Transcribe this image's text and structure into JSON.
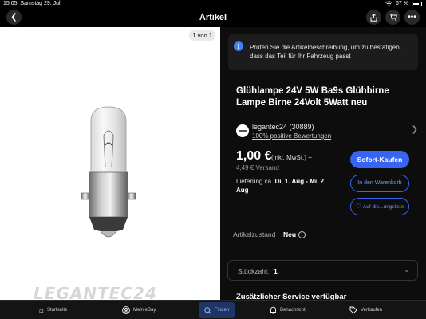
{
  "status_bar": {
    "time": "15:05",
    "date": "Samstag 29. Juli",
    "battery": "67 %"
  },
  "nav": {
    "title": "Artikel"
  },
  "gallery": {
    "counter": "1 von 1",
    "watermark": "LEGANTEC24"
  },
  "notice": {
    "text": "Prüfen Sie die Artikelbeschreibung, um zu bestätigen, dass das Teil für Ihr Fahrzeug passt"
  },
  "product": {
    "title": "Glühlampe 24V 5W Ba9s Glühbirne Lampe Birne 24Volt 5Watt neu"
  },
  "seller": {
    "name": "legantec24 (30889)",
    "feedback": "100% positive Bewertungen"
  },
  "pricing": {
    "price": "1,00 €",
    "price_suffix": "(inkl. MwSt.) +",
    "shipping": "4,49 € Versand",
    "delivery_prefix": "Lieferung ca. ",
    "delivery_dates": "Di, 1. Aug - Mi, 2. Aug"
  },
  "actions": {
    "buy_now": "Sofort-Kaufen",
    "add_to_cart": "In den Warenkorb",
    "watch": "Auf die...ungsliste"
  },
  "condition": {
    "label": "Artikelzustand",
    "value": "Neu"
  },
  "quantity": {
    "label": "Stückzahl:",
    "value": "1"
  },
  "services": {
    "heading": "Zusätzlicher Service verfügbar"
  },
  "tabs": [
    {
      "label": "Startseite",
      "icon": "home-icon"
    },
    {
      "label": "Mein eBay",
      "icon": "user-icon"
    },
    {
      "label": "Finden",
      "icon": "search-icon"
    },
    {
      "label": "Benachricht.",
      "icon": "bell-icon"
    },
    {
      "label": "Verkaufen",
      "icon": "tag-icon"
    }
  ],
  "colors": {
    "accent": "#3665f3",
    "info": "#3b82f6",
    "background": "#0d0d0d"
  }
}
